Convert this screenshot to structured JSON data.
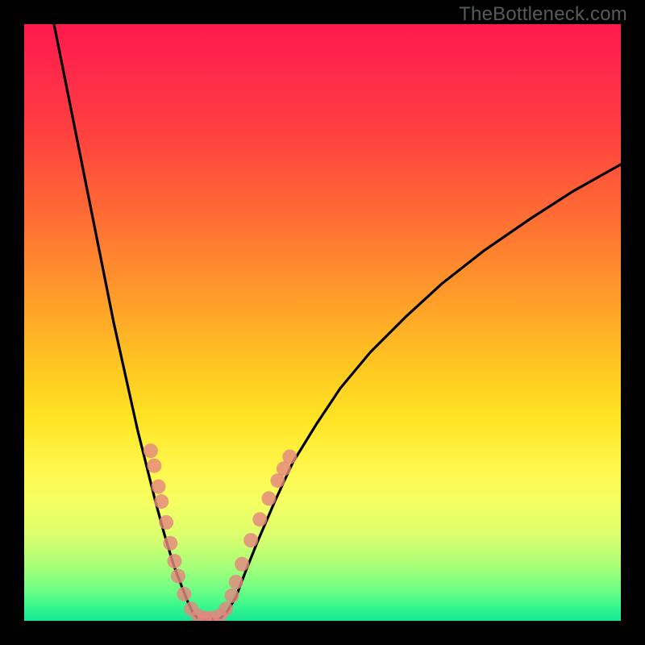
{
  "attribution": "TheBottleneck.com",
  "chart_data": {
    "type": "line",
    "title": "",
    "xlabel": "",
    "ylabel": "",
    "xlim": [
      0,
      100
    ],
    "ylim": [
      0,
      100
    ],
    "series": [
      {
        "name": "left-curve",
        "x": [
          5,
          7,
          9,
          11,
          13,
          15,
          17,
          19,
          20.5,
          22,
          23.5,
          25,
          26.5,
          27.5,
          28.3,
          29
        ],
        "y": [
          100,
          90,
          80,
          70,
          60,
          50,
          41,
          32,
          26,
          20,
          14.5,
          9.5,
          5.5,
          3,
          1.3,
          0.5
        ]
      },
      {
        "name": "valley-floor",
        "x": [
          29,
          30,
          31,
          32,
          33
        ],
        "y": [
          0.5,
          0.3,
          0.3,
          0.3,
          0.5
        ]
      },
      {
        "name": "right-curve",
        "x": [
          33,
          34,
          35.5,
          37,
          39,
          42,
          45,
          49,
          53,
          58,
          64,
          70,
          77,
          85,
          92,
          100
        ],
        "y": [
          0.5,
          1.5,
          4,
          8,
          13,
          20,
          26.5,
          33,
          39,
          45,
          51,
          56.5,
          62,
          67.5,
          72,
          76.5
        ]
      }
    ],
    "scatter_points": {
      "name": "highlight-dots",
      "color": "#e4877f",
      "radius_px": 9,
      "points": [
        {
          "x": 21.2,
          "y": 28.5
        },
        {
          "x": 21.8,
          "y": 26.0
        },
        {
          "x": 22.5,
          "y": 22.5
        },
        {
          "x": 23.0,
          "y": 20.0
        },
        {
          "x": 23.8,
          "y": 16.5
        },
        {
          "x": 24.5,
          "y": 13.0
        },
        {
          "x": 25.2,
          "y": 10.0
        },
        {
          "x": 25.8,
          "y": 7.5
        },
        {
          "x": 26.8,
          "y": 4.5
        },
        {
          "x": 28.0,
          "y": 2.0
        },
        {
          "x": 29.2,
          "y": 0.8
        },
        {
          "x": 30.3,
          "y": 0.5
        },
        {
          "x": 31.5,
          "y": 0.5
        },
        {
          "x": 32.8,
          "y": 0.8
        },
        {
          "x": 33.8,
          "y": 2.0
        },
        {
          "x": 34.8,
          "y": 4.2
        },
        {
          "x": 35.5,
          "y": 6.5
        },
        {
          "x": 36.5,
          "y": 9.5
        },
        {
          "x": 38.0,
          "y": 13.5
        },
        {
          "x": 39.5,
          "y": 17.0
        },
        {
          "x": 41.0,
          "y": 20.5
        },
        {
          "x": 42.5,
          "y": 23.5
        },
        {
          "x": 43.5,
          "y": 25.5
        },
        {
          "x": 44.5,
          "y": 27.5
        }
      ]
    },
    "background_gradient": {
      "top_color": "#ff1a4d",
      "bottom_color": "#18e695",
      "description": "red-to-green vertical gradient"
    }
  }
}
